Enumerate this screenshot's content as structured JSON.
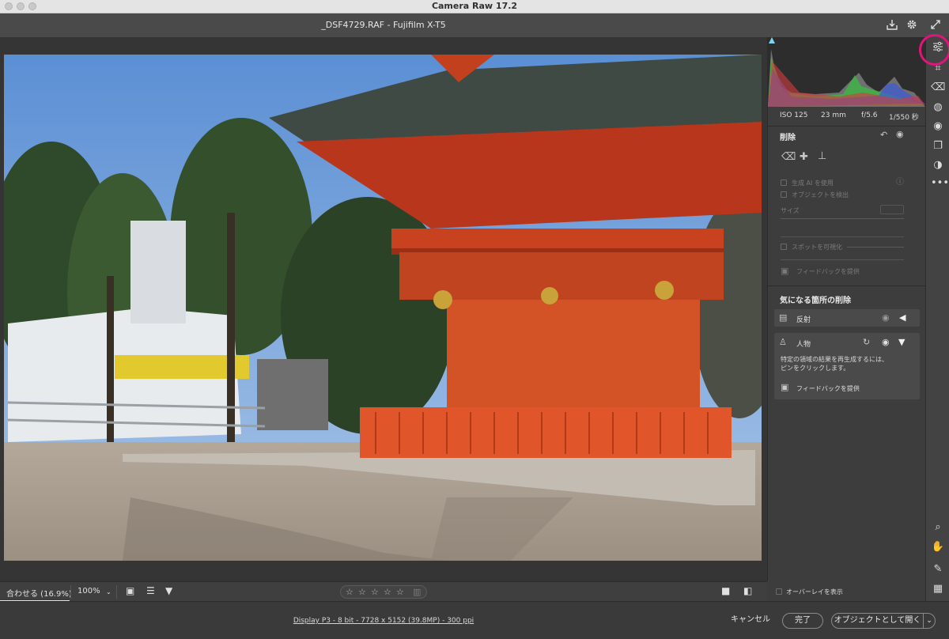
{
  "window": {
    "title": "Camera Raw 17.2"
  },
  "header": {
    "filename": "_DSF4729.RAF  -  Fujifilm X-T5"
  },
  "exif": {
    "iso": "ISO 125",
    "focal": "23 mm",
    "aperture": "f/5.6",
    "shutter": "1/550 秒"
  },
  "remove_panel": {
    "title": "削除",
    "gen_ai_label": "生成 AI を使用",
    "detect_objects_label": "オブジェクトを検出",
    "size_label": "サイズ",
    "visualize_spots_label": "スポットを可視化",
    "feedback_label": "フィードバックを提供"
  },
  "distraction_panel": {
    "title": "気になる箇所の削除",
    "reflection_label": "反射",
    "people_label": "人物",
    "people_hint_line1": "特定の領域の結果を再生成するには、",
    "people_hint_line2": "ピンをクリックします。",
    "feedback_label": "フィードバックを提供"
  },
  "bottom_toolbar": {
    "fit_label": "合わせる (16.9%)",
    "zoom_label": "100%",
    "overlay_label": "オーバーレイを表示"
  },
  "footer": {
    "info": "Display P3 - 8 bit - 7728 x 5152 (39.8MP) - 300 ppi",
    "cancel_label": "キャンセル",
    "done_label": "完了",
    "open_object_label": "オブジェクトとして開く"
  },
  "icons": {
    "header_right": [
      "save-icon",
      "settings-gear-icon",
      "fullscreen-icon"
    ],
    "tool_strip": [
      "edit-sliders-icon",
      "crop-icon",
      "remove-eraser-icon",
      "masking-icon",
      "red-eye-icon",
      "snapshots-icon",
      "presets-icon",
      "more-icon",
      "zoom-icon",
      "hand-icon",
      "color-sampler-icon",
      "grid-icon"
    ]
  },
  "colors": {
    "highlight_ring": "#e0157a",
    "panel_bg": "#3d3d3d",
    "canvas_bg": "#353535"
  }
}
